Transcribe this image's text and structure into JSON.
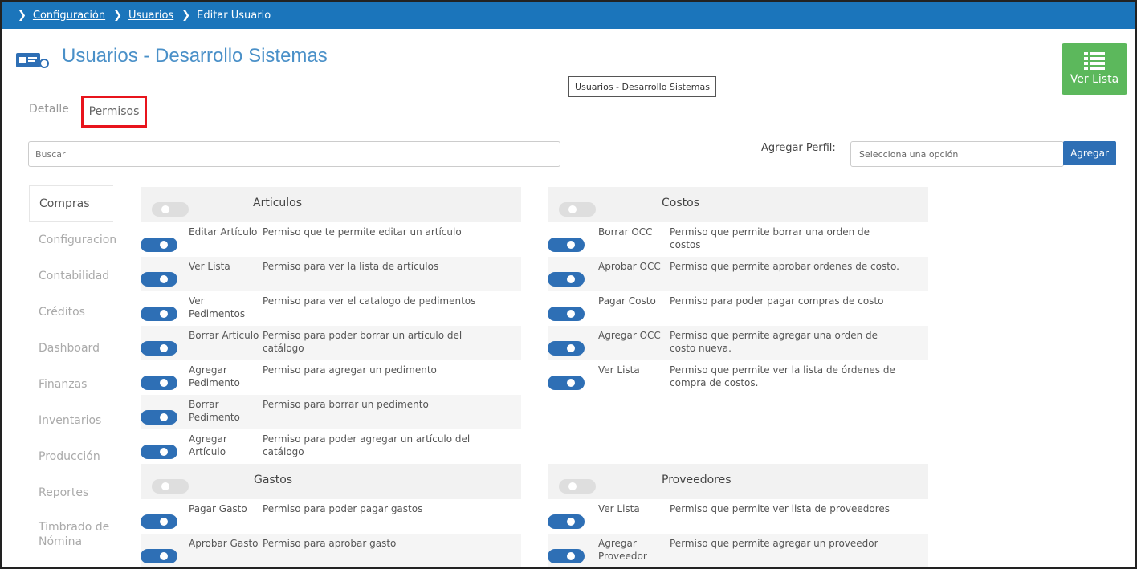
{
  "breadcrumb": {
    "items": [
      "Configuración",
      "Usuarios"
    ],
    "current": "Editar Usuario"
  },
  "header": {
    "title": "Usuarios - Desarrollo Sistemas",
    "tooltip": "Usuarios - Desarrollo Sistemas",
    "ver_lista_label": "Ver Lista"
  },
  "tabs": {
    "detalle": "Detalle",
    "permisos": "Permisos"
  },
  "search": {
    "placeholder": "Buscar"
  },
  "perfil": {
    "label": "Agregar Perfil:",
    "select_value": "Selecciona una opción",
    "button": "Agregar"
  },
  "sidemenu": [
    "Compras",
    "Configuracion",
    "Contabilidad",
    "Créditos",
    "Dashboard",
    "Finanzas",
    "Inventarios",
    "Producción",
    "Reportes",
    "Timbrado de Nómina"
  ],
  "panels": {
    "articulos": {
      "title": "Articulos",
      "rows": [
        {
          "name": "Editar Artículo",
          "desc": "Permiso que te permite editar un artículo"
        },
        {
          "name": "Ver Lista",
          "desc": "Permiso para ver la lista de artículos"
        },
        {
          "name": "Ver Pedimentos",
          "desc": "Permiso para ver el catalogo de pedimentos"
        },
        {
          "name": "Borrar Artículo",
          "desc": "Permiso para poder borrar un artículo del catálogo"
        },
        {
          "name": "Agregar Pedimento",
          "desc": "Permiso para agregar un pedimento"
        },
        {
          "name": "Borrar Pedimento",
          "desc": "Permiso para borrar un pedimento"
        },
        {
          "name": "Agregar Artículo",
          "desc": "Permiso para poder agregar un artículo del catálogo"
        }
      ]
    },
    "costos": {
      "title": "Costos",
      "rows": [
        {
          "name": "Borrar OCC",
          "desc": "Permiso que permite borrar una orden de costos"
        },
        {
          "name": "Aprobar OCC",
          "desc": "Permiso que permite aprobar ordenes de costo."
        },
        {
          "name": "Pagar Costo",
          "desc": "Permiso para poder pagar compras de costo"
        },
        {
          "name": "Agregar OCC",
          "desc": "Permiso que permite agregar una orden de costo nueva."
        },
        {
          "name": "Ver Lista",
          "desc": "Permiso que permite ver la lista de órdenes de compra de costos."
        }
      ]
    },
    "gastos": {
      "title": "Gastos",
      "rows": [
        {
          "name": "Pagar Gasto",
          "desc": "Permiso para poder pagar gastos"
        },
        {
          "name": "Aprobar Gasto",
          "desc": "Permiso para aprobar gasto"
        }
      ]
    },
    "proveedores": {
      "title": "Proveedores",
      "rows": [
        {
          "name": "Ver Lista",
          "desc": "Permiso que permite ver lista de proveedores"
        },
        {
          "name": "Agregar Proveedor",
          "desc": "Permiso que permite agregar un proveedor"
        }
      ]
    }
  },
  "colors": {
    "breadcrumb_bar": "#1b75bb",
    "toggle_on": "#2e6fb5",
    "toggle_off": "#dedede",
    "ver_lista_button": "#5cb85c",
    "tab_highlight": "#e8141c"
  }
}
